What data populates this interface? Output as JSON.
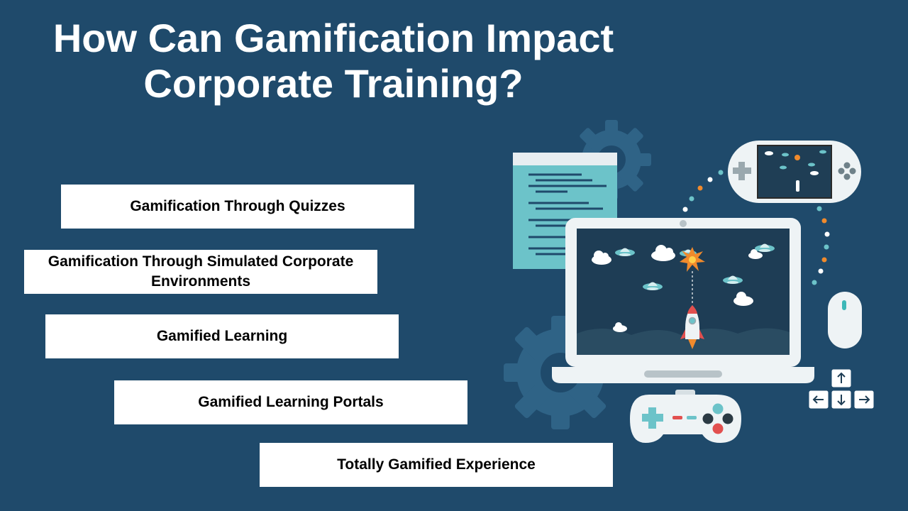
{
  "title": {
    "line1": "How Can Gamification Impact",
    "line2": "Corporate Training?"
  },
  "items": [
    {
      "label": "Gamification Through Quizzes"
    },
    {
      "label": "Gamification Through Simulated Corporate Environments"
    },
    {
      "label": "Gamified Learning"
    },
    {
      "label": "Gamified Learning Portals"
    },
    {
      "label": "Totally Gamified Experience"
    }
  ],
  "colors": {
    "background": "#1f4a6b",
    "box": "#ffffff",
    "accent_teal": "#6cc3c9",
    "accent_orange": "#f08a2c",
    "accent_red": "#e2504f"
  },
  "illustration": {
    "icons": [
      "gear-icon",
      "document-icon",
      "laptop-icon",
      "handheld-console-icon",
      "rocket-icon",
      "ufo-icon",
      "cloud-icon",
      "mouse-icon",
      "arrow-keys-icon",
      "gamepad-icon"
    ]
  }
}
